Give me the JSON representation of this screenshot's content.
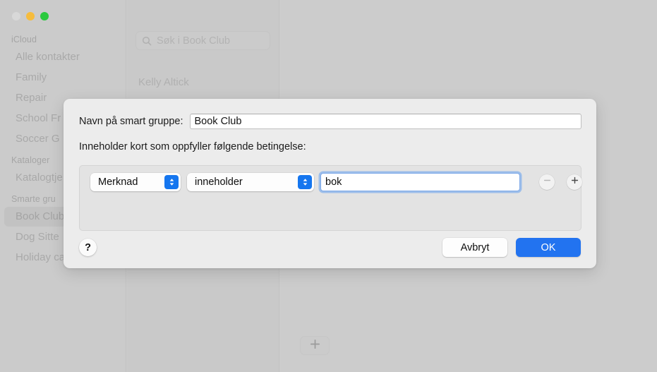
{
  "window": {
    "traffic_lights": [
      "close",
      "minimize",
      "maximize"
    ]
  },
  "sidebar": {
    "sections": [
      {
        "header": "iCloud",
        "items": [
          "Alle kontakter",
          "Family",
          "Repair",
          "School Fr",
          "Soccer G"
        ]
      },
      {
        "header": "Kataloger",
        "items": [
          "Katalogtje"
        ]
      },
      {
        "header": "Smarte gru",
        "items": [
          "Book Club",
          "Dog Sitte",
          "Holiday cards"
        ]
      }
    ],
    "selected": "Book Club"
  },
  "list_column": {
    "search_placeholder": "Søk i Book Club",
    "search_icon": "search-icon",
    "contacts": [
      "Kelly Altick"
    ]
  },
  "detail_column": {
    "add_button_icon": "plus-icon"
  },
  "dialog": {
    "name_label": "Navn på smart gruppe:",
    "name_value": "Book Club",
    "name_placeholder": "",
    "condition_label": "Inneholder kort som oppfyller følgende betingelse:",
    "criteria": [
      {
        "field": "Merknad",
        "operator": "inneholder",
        "value": "bok",
        "value_placeholder": "",
        "remove_label": "−",
        "add_label": "+"
      }
    ],
    "help_label": "?",
    "cancel_label": "Avbryt",
    "ok_label": "OK",
    "colors": {
      "accent": "#2273f0",
      "popup_arrow": "#1576ef",
      "sheet_bg": "#ececec",
      "criteria_bg": "#e3e3e3"
    }
  }
}
